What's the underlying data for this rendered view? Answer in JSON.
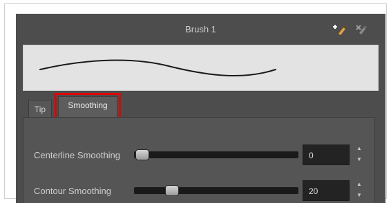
{
  "header": {
    "title": "Brush 1",
    "icons": [
      "new-brush-icon",
      "delete-brush-icon"
    ]
  },
  "tabs": [
    {
      "label": "Tip",
      "active": false
    },
    {
      "label": "Smoothing",
      "active": true
    }
  ],
  "smoothing": {
    "centerline": {
      "label": "Centerline Smoothing",
      "value": "0",
      "fraction": 0.0
    },
    "contour": {
      "label": "Contour Smoothing",
      "value": "20",
      "fraction": 0.2
    }
  },
  "colors": {
    "panel": "#4d4d4d",
    "highlight": "#e00000",
    "preview_bg": "#e3e3e3"
  }
}
